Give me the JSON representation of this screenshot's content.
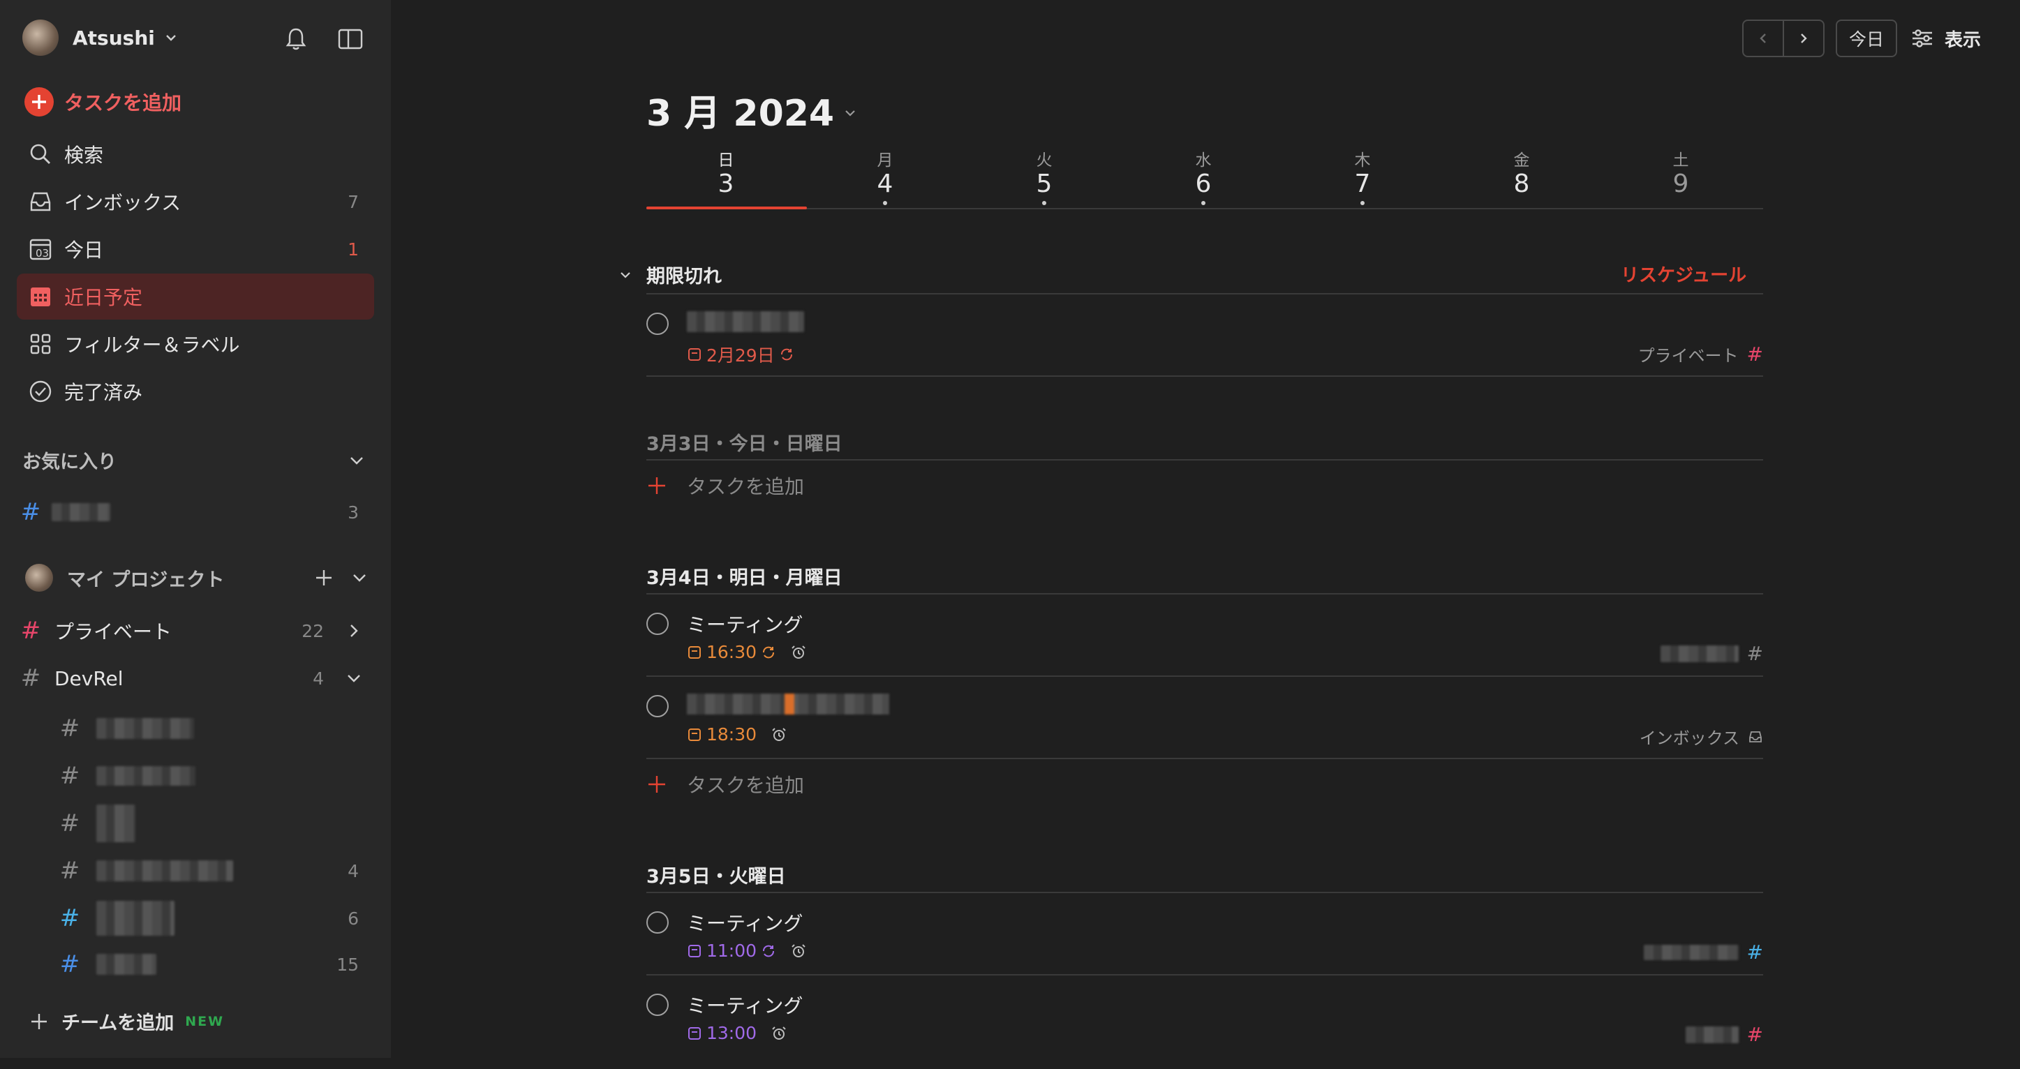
{
  "user": {
    "name": "Atsushi"
  },
  "sidebar": {
    "add_task": "タスクを追加",
    "nav": [
      {
        "label": "検索",
        "count": ""
      },
      {
        "label": "インボックス",
        "count": "7"
      },
      {
        "label": "今日",
        "count": "1",
        "icon_text": "03"
      },
      {
        "label": "近日予定",
        "count": ""
      },
      {
        "label": "フィルター＆ラベル",
        "count": ""
      },
      {
        "label": "完了済み",
        "count": ""
      }
    ],
    "favorites_title": "お気に入り",
    "favorites": [
      {
        "count": "3",
        "color": "#4a8fe8"
      }
    ],
    "projects_title": "マイ プロジェクト",
    "projects": [
      {
        "label": "プライベート",
        "count": "22",
        "color": "#e8466a"
      },
      {
        "label": "DevRel",
        "count": "4",
        "color": "#8a8a8a"
      }
    ],
    "subprojects": [
      {
        "count": "",
        "color": "#8a8a8a"
      },
      {
        "count": "",
        "color": "#8a8a8a"
      },
      {
        "count": "",
        "color": "#8a8a8a"
      },
      {
        "count": "4",
        "color": "#8a8a8a"
      },
      {
        "count": "6",
        "color": "#4ab2e8"
      },
      {
        "count": "15",
        "color": "#4a8fe8"
      }
    ],
    "add_team": "チームを追加",
    "new_badge": "NEW"
  },
  "toolbar": {
    "today": "今日",
    "view": "表示"
  },
  "month_title": "3 月 2024",
  "week": [
    {
      "name": "日",
      "num": "3",
      "dot": false,
      "selected": true
    },
    {
      "name": "月",
      "num": "4",
      "dot": true
    },
    {
      "name": "火",
      "num": "5",
      "dot": true
    },
    {
      "name": "水",
      "num": "6",
      "dot": true
    },
    {
      "name": "木",
      "num": "7",
      "dot": true
    },
    {
      "name": "金",
      "num": "8",
      "dot": false
    },
    {
      "name": "土",
      "num": "9",
      "dot": false
    }
  ],
  "overdue": {
    "title": "期限切れ",
    "reschedule": "リスケジュール",
    "task": {
      "date": "2月29日",
      "project": "プライベート"
    }
  },
  "sections": [
    {
      "title": "3月3日・今日・日曜日",
      "add": "タスクを追加"
    },
    {
      "title": "3月4日・明日・月曜日",
      "add": "タスクを追加",
      "tasks": [
        {
          "name": "ミーティング",
          "time": "16:30"
        },
        {
          "time": "18:30",
          "project": "インボックス"
        }
      ]
    },
    {
      "title": "3月5日・火曜日",
      "tasks": [
        {
          "name": "ミーティング",
          "time": "11:00"
        },
        {
          "name": "ミーティング",
          "time": "13:00"
        }
      ]
    }
  ],
  "colors": {
    "accent": "#e44332",
    "overdue": "#e05a4a",
    "tomorrow": "#e88a3a",
    "week": "#a06ae8",
    "active_bg": "#4d2424"
  }
}
